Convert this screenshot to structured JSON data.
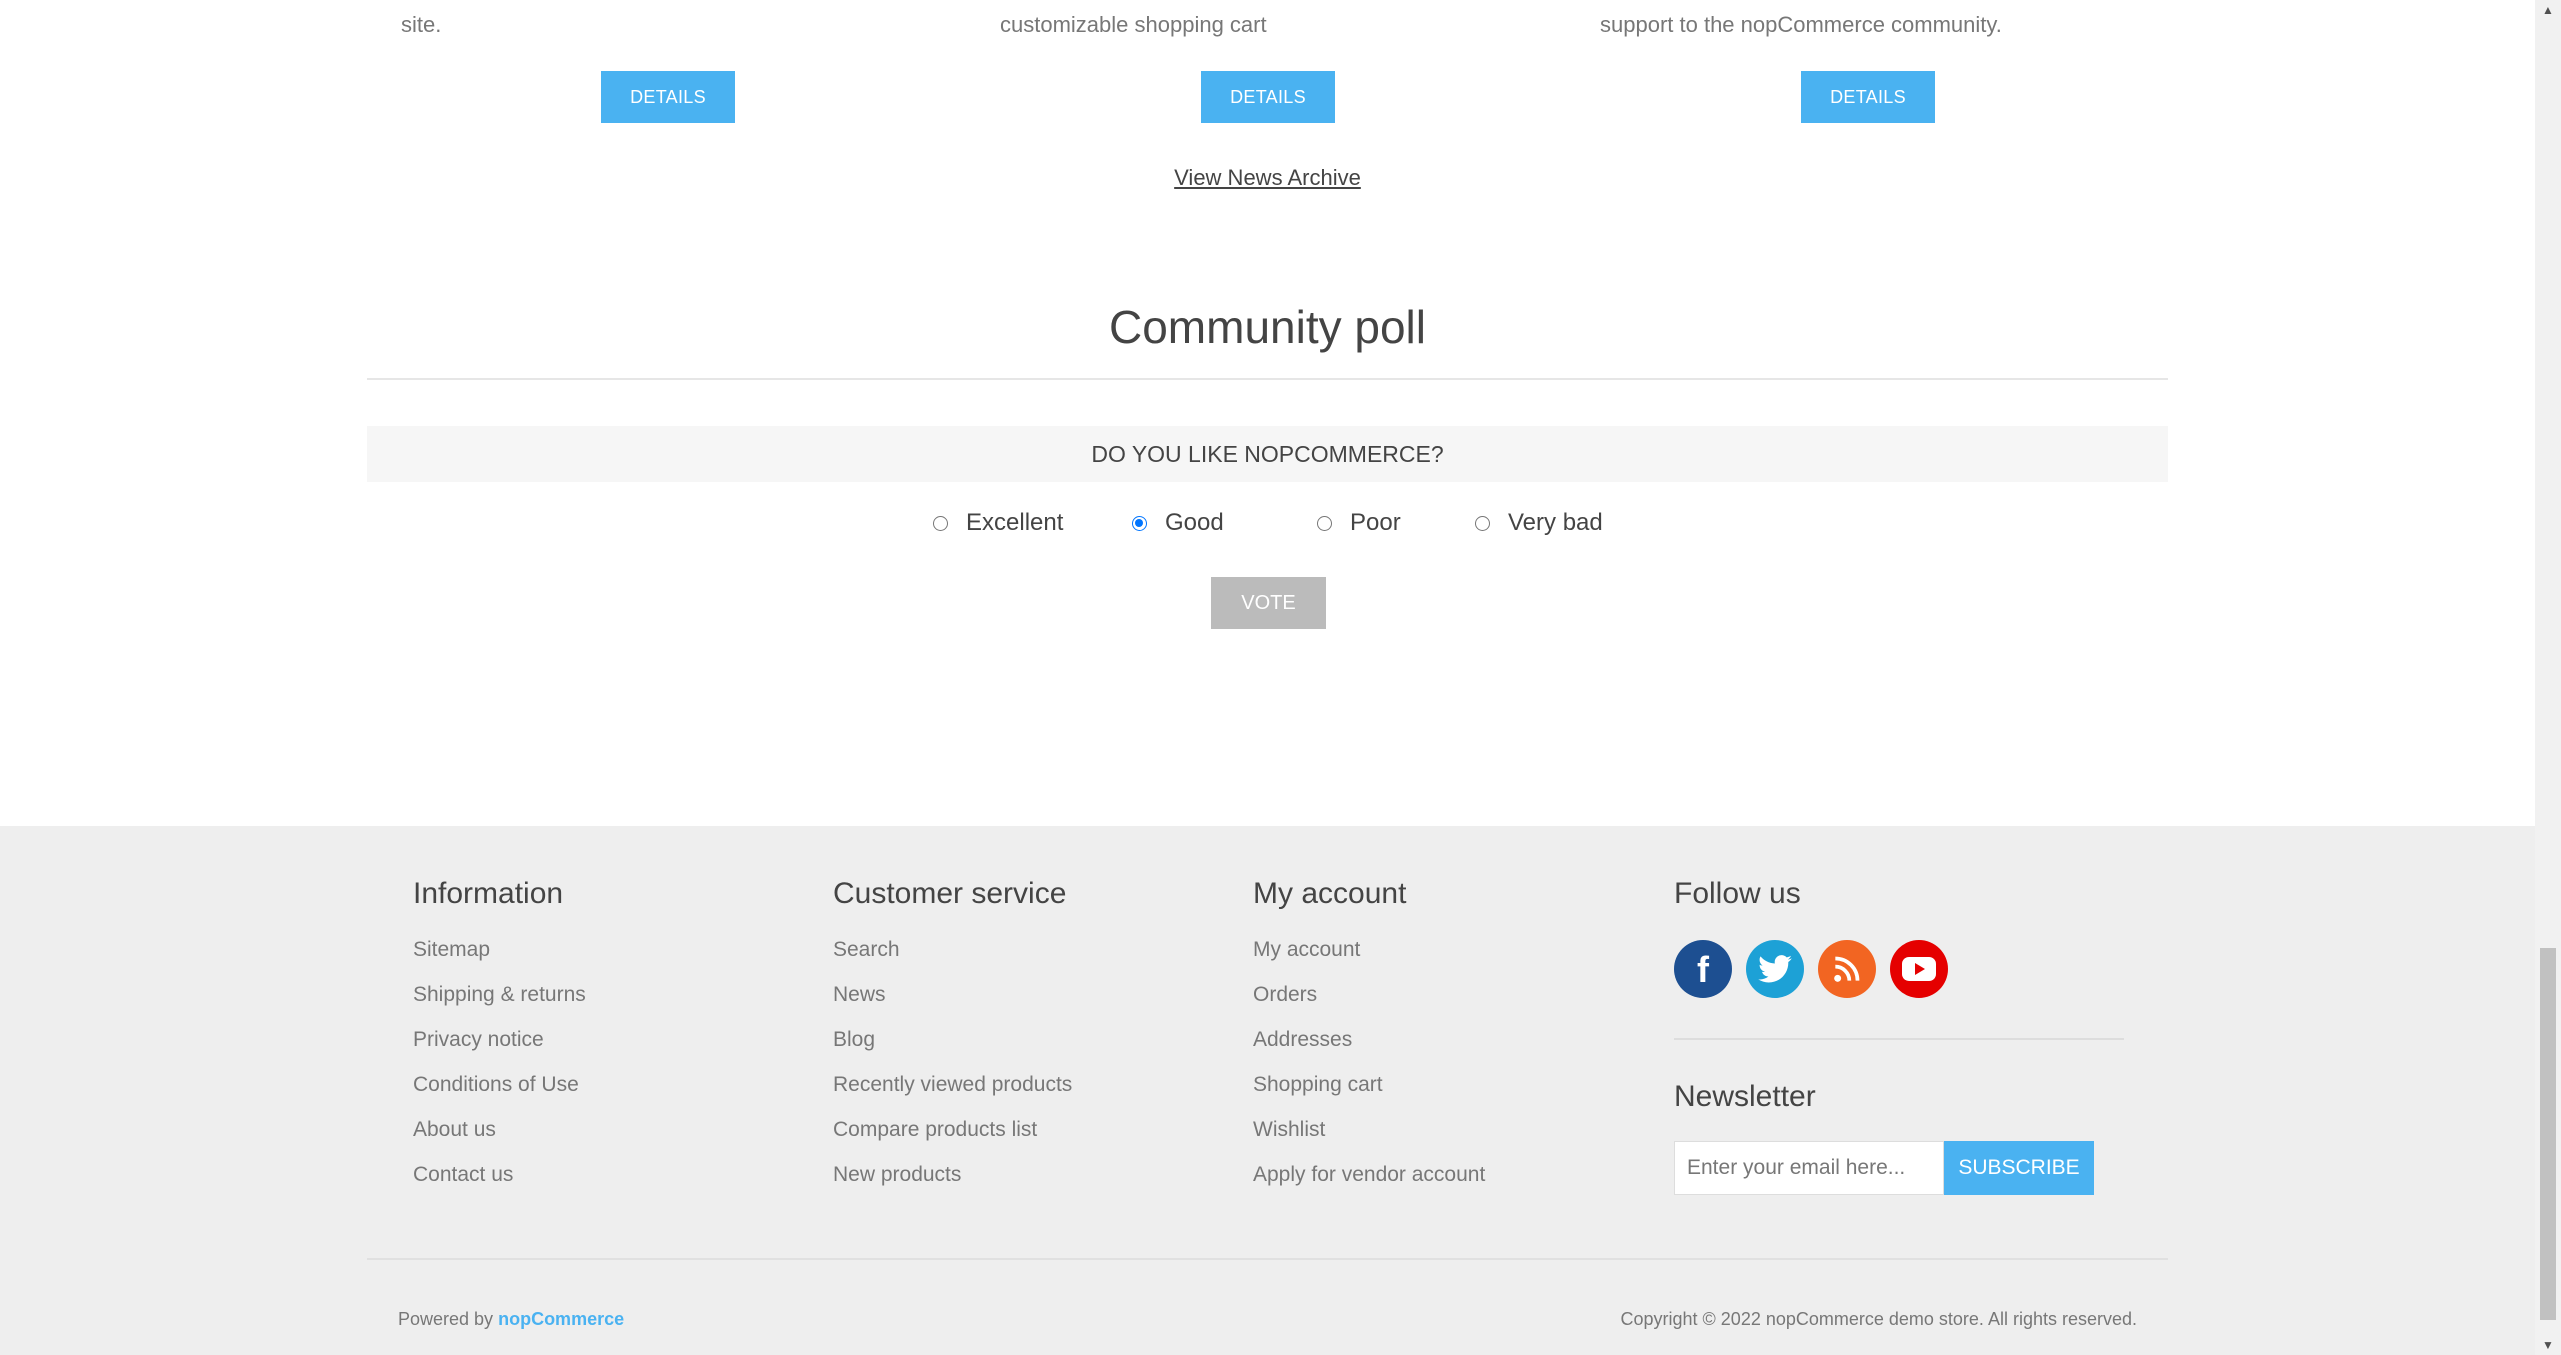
{
  "news": {
    "fragments": [
      {
        "text": "site."
      },
      {
        "text": "customizable shopping cart"
      },
      {
        "text": "support to the nopCommerce community."
      }
    ],
    "details_label": "DETAILS",
    "archive_label": "View News Archive"
  },
  "poll": {
    "title": "Community poll",
    "question": "DO YOU LIKE NOPCOMMERCE?",
    "options": [
      {
        "label": "Excellent",
        "selected": false
      },
      {
        "label": "Good",
        "selected": true
      },
      {
        "label": "Poor",
        "selected": false
      },
      {
        "label": "Very bad",
        "selected": false
      }
    ],
    "vote_label": "VOTE"
  },
  "footer": {
    "information": {
      "title": "Information",
      "items": [
        "Sitemap",
        "Shipping & returns",
        "Privacy notice",
        "Conditions of Use",
        "About us",
        "Contact us"
      ]
    },
    "customer_service": {
      "title": "Customer service",
      "items": [
        "Search",
        "News",
        "Blog",
        "Recently viewed products",
        "Compare products list",
        "New products"
      ]
    },
    "my_account": {
      "title": "My account",
      "items": [
        "My account",
        "Orders",
        "Addresses",
        "Shopping cart",
        "Wishlist",
        "Apply for vendor account"
      ]
    },
    "follow_us": {
      "title": "Follow us",
      "icons": [
        "facebook-icon",
        "twitter-icon",
        "rss-icon",
        "youtube-icon"
      ],
      "colors": {
        "facebook": "#1d4f91",
        "twitter": "#1da1d6",
        "rss": "#f26522",
        "youtube": "#e50000"
      }
    },
    "newsletter": {
      "title": "Newsletter",
      "placeholder": "Enter your email here...",
      "subscribe_label": "SUBSCRIBE"
    },
    "powered_prefix": "Powered by",
    "powered_link": "nopCommerce",
    "copyright": "Copyright © 2022 nopCommerce demo store. All rights reserved."
  },
  "colors": {
    "accent": "#4ab2f1",
    "footer_bg": "#eeeeee",
    "vote_bg": "#bbbbbb"
  }
}
